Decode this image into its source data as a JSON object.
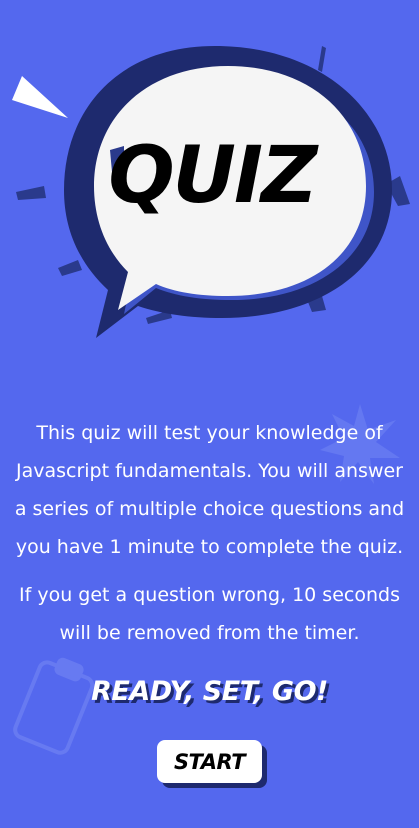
{
  "hero": {
    "title": "QUIZ",
    "icon": "speech-bubble-icon"
  },
  "intro": {
    "paragraph_1": "This quiz will test your knowledge of Javascript fundamentals. You will answer a series of multiple choice questions and you have 1 minute to complete the quiz.",
    "paragraph_2": "If you get a question wrong, 10 seconds will be removed from the timer."
  },
  "tagline": "READY, SET, GO!",
  "start_button": {
    "label": "START"
  },
  "colors": {
    "background": "#5468EE",
    "dark_navy": "#1E2A6E",
    "bubble": "#F5F5F5",
    "text": "#FFFFFF"
  }
}
